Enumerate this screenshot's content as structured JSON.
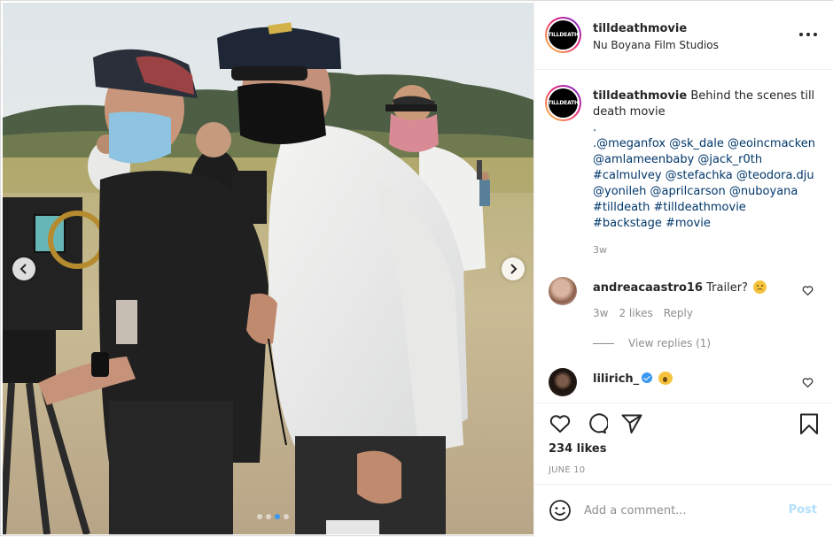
{
  "post": {
    "username": "tilldeathmovie",
    "location": "Nu Boyana Film Studios",
    "avatar_logo": "TILLDEATH"
  },
  "caption": {
    "username": "tilldeathmovie",
    "text": "Behind the scenes till death movie",
    "body": ".\n.@meganfox @sk_dale @eoincmacken @amlameenbaby @jack_r0th #calmulvey @stefachka @teodora.dju @yonileh @aprilcarson @nuboyana #tilldeath #tilldeathmovie #backstage #movie",
    "time": "3w"
  },
  "comments": [
    {
      "username": "andreacaastro16",
      "text": "Trailer?",
      "emoji": "sad-face",
      "time": "3w",
      "likes": "2 likes",
      "reply_label": "Reply",
      "view_replies": "View replies (1)"
    },
    {
      "username": "lilirich_",
      "verified": true,
      "emoji": "screaming-face"
    }
  ],
  "actions": {
    "likes": "234 likes",
    "date": "JUNE 10"
  },
  "composer": {
    "placeholder": "Add a comment...",
    "post_label": "Post"
  },
  "carousel": {
    "slide_count": 4,
    "active_index": 2
  },
  "colors": {
    "accent": "#3897f0",
    "link": "#00376b",
    "muted": "#8e8e8e",
    "post_disabled": "#b2dffc"
  }
}
